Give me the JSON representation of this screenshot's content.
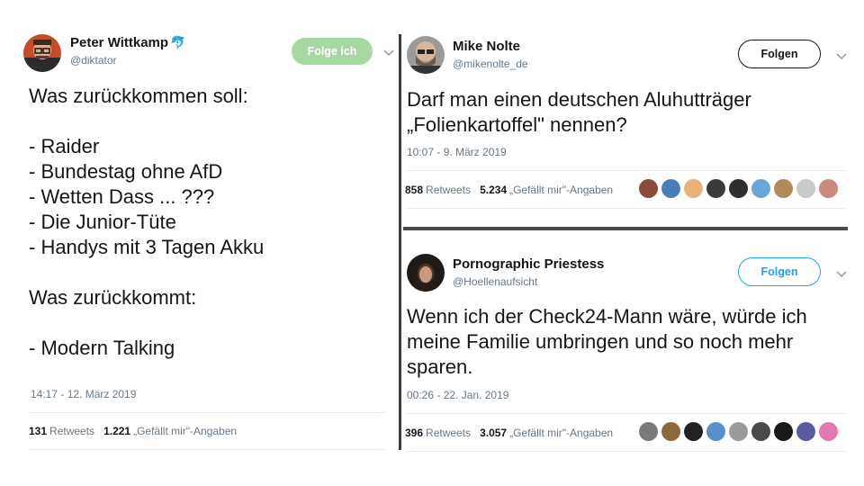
{
  "tweets": [
    {
      "display_name": "Peter Wittkamp",
      "handle": "@diktator",
      "follow_label": "Folge ich",
      "text": "Was zurückkommen soll:\n\n- Raider\n- Bundestag ohne AfD\n- Wetten Dass ... ???\n- Die Junior-Tüte\n- Handys mit 3 Tagen Akku\n\nWas zurückkommt:\n\n- Modern Talking",
      "timestamp": "14:17 - 12. März 2019",
      "retweets_count": "131",
      "retweets_label": "Retweets",
      "likes_count": "1.221",
      "likes_label": "„Gefällt mir\"-Angaben",
      "liker_colors": []
    },
    {
      "display_name": "Mike Nolte",
      "handle": "@mikenolte_de",
      "follow_label": "Folgen",
      "text": "Darf man einen deutschen Aluhutträger\n„Folienkartoffel\" nennen?",
      "timestamp": "10:07 - 9. März 2019",
      "retweets_count": "858",
      "retweets_label": "Retweets",
      "likes_count": "5.234",
      "likes_label": "„Gefällt mir\"-Angaben",
      "liker_colors": [
        "#8a4b3a",
        "#4a7fb5",
        "#e8b27a",
        "#3b3b3b",
        "#2f2f2f",
        "#6aa5d8",
        "#b08a5a",
        "#c9c9c9",
        "#c98a7a"
      ]
    },
    {
      "display_name": "Pornographic Priestess",
      "handle": "@Hoellenaufsicht",
      "follow_label": "Folgen",
      "text": "Wenn ich der Check24-Mann wäre, würde ich\nmeine Familie umbringen und so noch mehr\nsparen.",
      "timestamp": "00:26 - 22. Jan. 2019",
      "retweets_count": "396",
      "retweets_label": "Retweets",
      "likes_count": "3.057",
      "likes_label": "„Gefällt mir\"-Angaben",
      "liker_colors": [
        "#7a7a7a",
        "#8a6a3a",
        "#222222",
        "#5a8fc8",
        "#9a9a9a",
        "#4a4a4a",
        "#1a1a1a",
        "#5a5aa0",
        "#e07ab0"
      ]
    }
  ],
  "colors": {
    "name": "#14171a",
    "secondary": "#657786",
    "follow_blue": "#1da1f2",
    "following_green": "#a7d8a1",
    "divider": "#3d3d3d"
  },
  "icons": [
    "verified-badge-icon",
    "chevron-down-icon"
  ]
}
